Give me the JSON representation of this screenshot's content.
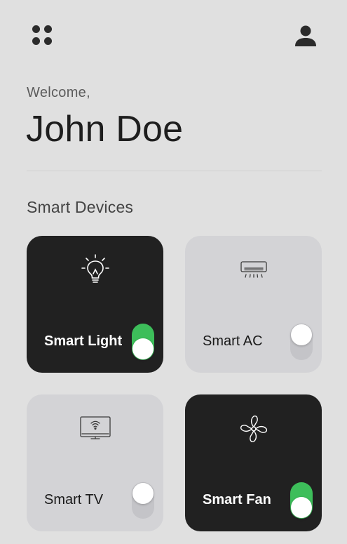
{
  "header": {
    "menu_icon": "grid-dots-icon",
    "profile_icon": "user-icon"
  },
  "greeting": {
    "welcome": "Welcome,",
    "name": "John Doe"
  },
  "section": {
    "title": "Smart Devices"
  },
  "devices": [
    {
      "label": "Smart Light",
      "icon": "lightbulb-icon",
      "state": "on"
    },
    {
      "label": "Smart AC",
      "icon": "air-conditioner-icon",
      "state": "off"
    },
    {
      "label": "Smart TV",
      "icon": "tv-icon",
      "state": "off"
    },
    {
      "label": "Smart Fan",
      "icon": "fan-icon",
      "state": "on"
    }
  ],
  "colors": {
    "background": "#e0e0e0",
    "card_on": "#212121",
    "card_off": "#d3d3d6",
    "toggle_on": "#3dbe5a",
    "toggle_off": "#c4c4c8"
  }
}
